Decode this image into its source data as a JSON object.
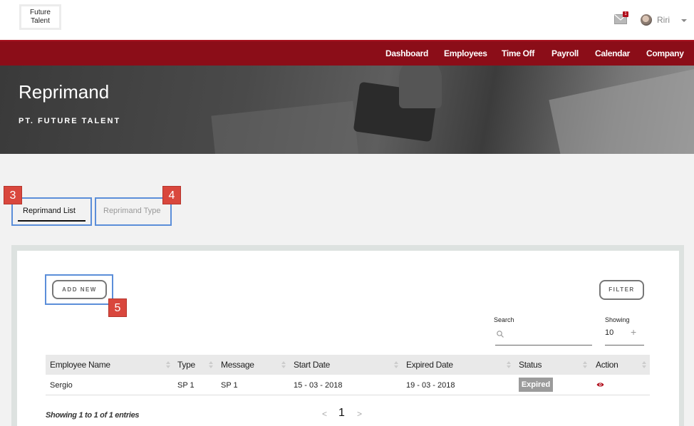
{
  "header": {
    "logo_line1": "Future",
    "logo_line2": "Talent",
    "mail_count": "1",
    "username": "Riri"
  },
  "nav": {
    "items": [
      "Dashboard",
      "Employees",
      "Time Off",
      "Payroll",
      "Calendar",
      "Company"
    ]
  },
  "hero": {
    "title": "Reprimand",
    "subtitle": "PT. FUTURE TALENT"
  },
  "tabs": [
    {
      "label": "Reprimand List",
      "active": true
    },
    {
      "label": "Reprimand Type",
      "active": false
    }
  ],
  "markers": [
    "3",
    "4",
    "5"
  ],
  "toolbar": {
    "add_label": "ADD NEW",
    "filter_label": "FILTER",
    "search_label": "Search",
    "search_placeholder": "",
    "showing_label": "Showing",
    "showing_value": "10",
    "showing_plus": "+"
  },
  "table": {
    "columns": [
      "Employee Name",
      "Type",
      "Message",
      "Start Date",
      "Expired Date",
      "Status",
      "Action"
    ],
    "rows": [
      {
        "employee": "Sergio",
        "type": "SP 1",
        "message": "SP 1",
        "start": "15 - 03 - 2018",
        "expired": "19 - 03 - 2018",
        "status": "Expired"
      }
    ]
  },
  "footer": {
    "entries_text": "Showing 1 to 1 of 1 entries",
    "prev": "<",
    "page": "1",
    "next": ">"
  },
  "colors": {
    "brand_red": "#8b0d18",
    "marker_red": "#d9473d",
    "highlight_blue": "#5b8ed9",
    "status_gray": "#9b9b9b"
  },
  "icons": [
    "mail-icon",
    "avatar",
    "chevron-down-icon",
    "search-icon",
    "sort-icon",
    "eye-icon"
  ]
}
